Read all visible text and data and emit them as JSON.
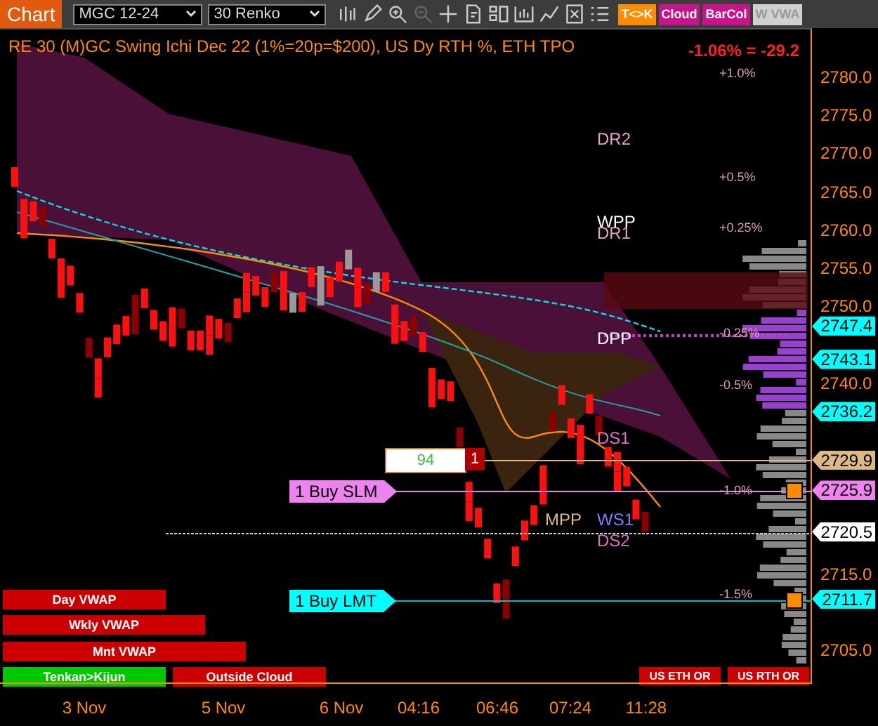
{
  "toolbar": {
    "tab": "Chart",
    "instrument": "MGC 12-24",
    "period": "30 Renko",
    "toggles": [
      {
        "label": "T<>K",
        "color": "#ff8c00",
        "enabled": true
      },
      {
        "label": "Cloud",
        "color": "#c8148c",
        "enabled": true
      },
      {
        "label": "BarCol",
        "color": "#c8148c",
        "enabled": true
      },
      {
        "label": "W VWA",
        "color": "#d0d0d0",
        "enabled": false
      }
    ]
  },
  "chart": {
    "title": "RE 30 (M)GC Swing Ichi Dec 22 (1%=20p=$200), US Dy RTH %, ETH TPO",
    "change": "-1.06% = -29.2",
    "percent_levels": [
      "+1.0%",
      "+0.5%",
      "+0.25%",
      "-0.25%",
      "-0.5%",
      "-1.0%",
      "-1.5%"
    ],
    "pivots": [
      "DR2",
      "WPP",
      "DR1",
      "DPP",
      "DS1",
      "MPP",
      "WS1",
      "DS2"
    ],
    "orders": [
      {
        "label": "1 Buy SLM",
        "color": "#ee82ee"
      },
      {
        "label": "1 Buy LMT",
        "color": "#00ffff"
      }
    ],
    "position": {
      "pnl": "94",
      "quantity": "1"
    },
    "indicator_bars": [
      {
        "label": "Day VWAP",
        "color": "#cc0000"
      },
      {
        "label": "Wkly VWAP",
        "color": "#cc0000"
      },
      {
        "label": "Mnt VWAP",
        "color": "#cc0000"
      },
      {
        "label": "Tenkan>Kijun",
        "color": "#00c800"
      },
      {
        "label": "Outside Cloud",
        "color": "#cc0000"
      }
    ],
    "session_bars": [
      "US ETH OR",
      "US RTH OR"
    ]
  },
  "price_axis": {
    "ticks": [
      "2780.0",
      "2775.0",
      "2770.0",
      "2765.0",
      "2760.0",
      "2755.0",
      "2750.0",
      "2740.0",
      "2715.0",
      "2705.0"
    ],
    "flags": [
      {
        "price": "2747.4",
        "color": "#00ffff"
      },
      {
        "price": "2743.1",
        "color": "#00ffff"
      },
      {
        "price": "2736.2",
        "color": "#00ffff"
      },
      {
        "price": "2729.9",
        "color": "#deb887"
      },
      {
        "price": "2725.9",
        "color": "#ee82ee"
      },
      {
        "price": "2720.5",
        "color": "#ffffff"
      },
      {
        "price": "2711.7",
        "color": "#00ffff"
      }
    ]
  },
  "time_axis": {
    "ticks": [
      "3 Nov",
      "5 Nov",
      "6 Nov",
      "04:16",
      "06:46",
      "07:24",
      "11:28"
    ]
  }
}
